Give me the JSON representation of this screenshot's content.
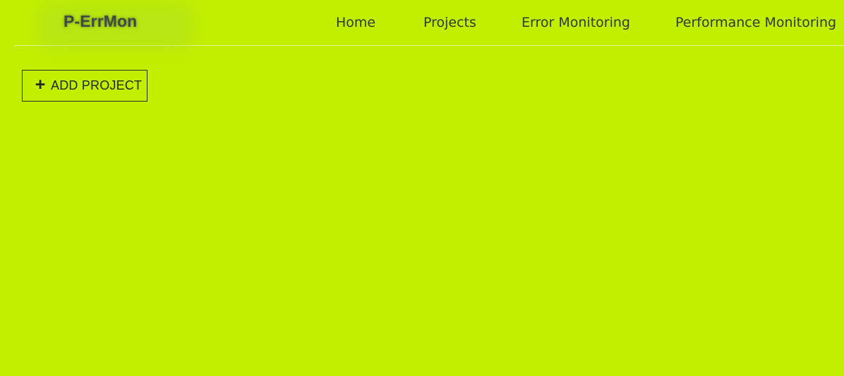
{
  "app": {
    "brand": "P-ErrMon",
    "background_color": "#c2ef00",
    "text_color": "#2f3a34"
  },
  "navigation": {
    "links": [
      {
        "label": "Home"
      },
      {
        "label": "Projects"
      },
      {
        "label": "Error Monitoring"
      },
      {
        "label": "Performance Monitoring"
      }
    ]
  },
  "actions": {
    "add_project": {
      "label": "ADD PROJECT",
      "icon": "plus-icon"
    }
  }
}
